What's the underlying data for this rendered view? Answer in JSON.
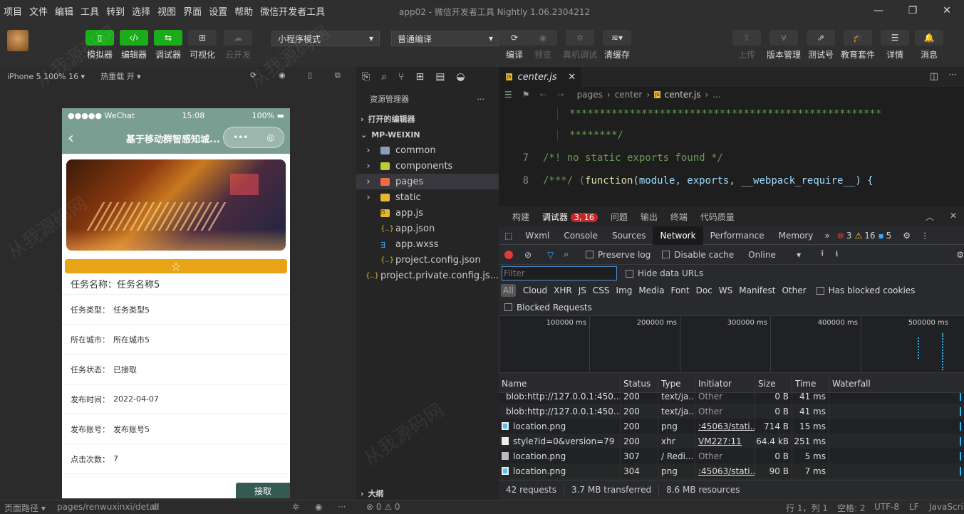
{
  "menu": [
    "项目",
    "文件",
    "编辑",
    "工具",
    "转到",
    "选择",
    "视图",
    "界面",
    "设置",
    "帮助",
    "微信开发者工具"
  ],
  "window_title": "app02 - 微信开发者工具 Nightly 1.06.2304212",
  "toolbar": {
    "simulator": "模拟器",
    "editor": "编辑器",
    "debugger": "调试器",
    "visual": "可视化",
    "cloud": "云开发",
    "mode_select": "小程序模式",
    "compile_select": "普通编译",
    "compile": "编译",
    "preview": "预览",
    "real_debug": "真机调试",
    "clear_cache": "清缓存",
    "upload": "上传",
    "version": "版本管理",
    "test": "测试号",
    "education": "教育套件",
    "details": "详情",
    "messages": "消息"
  },
  "sim_header": {
    "device": "iPhone 5 100% 16 ▾",
    "hot_reload": "热重载 开 ▾"
  },
  "phone": {
    "carrier": "●●●●● WeChat",
    "time": "15:08",
    "battery": "100%",
    "title": "基于移动群智感知城...",
    "rows": [
      {
        "key": "任务名称：",
        "value": "任务名称5"
      },
      {
        "key": "任务类型：",
        "value": "任务类型5"
      },
      {
        "key": "所在城市：",
        "value": "所在城市5"
      },
      {
        "key": "任务状态：",
        "value": "已接取"
      },
      {
        "key": "发布时间：",
        "value": "2022-04-07"
      },
      {
        "key": "发布账号：",
        "value": "发布账号5"
      },
      {
        "key": "点击次数：",
        "value": "7"
      }
    ],
    "accept_button": "接取"
  },
  "explorer": {
    "header": "资源管理器",
    "open_editors": "打开的编辑器",
    "root": "MP-WEIXIN",
    "items": [
      {
        "name": "common",
        "kind": "folder"
      },
      {
        "name": "components",
        "kind": "folder"
      },
      {
        "name": "pages",
        "kind": "folder"
      },
      {
        "name": "static",
        "kind": "folder"
      },
      {
        "name": "app.js",
        "kind": "js"
      },
      {
        "name": "app.json",
        "kind": "json"
      },
      {
        "name": "app.wxss",
        "kind": "css"
      },
      {
        "name": "project.config.json",
        "kind": "json"
      },
      {
        "name": "project.private.config.js...",
        "kind": "json"
      }
    ],
    "outline": "大纲"
  },
  "editor": {
    "tab": "center.js",
    "breadcrumb": [
      "pages",
      "center",
      "center.js",
      "..."
    ],
    "lines": [
      {
        "num": "",
        "text": "****************************************************"
      },
      {
        "num": "",
        "text": "********/"
      },
      {
        "num": "7",
        "text": "/*! no static exports found */"
      },
      {
        "num": "8",
        "text_pre": "/***/ (",
        "text_fn": "function",
        "text_args": "(module, exports, __webpack_require__) {"
      }
    ]
  },
  "devtools": {
    "top_tabs": [
      "构建",
      "调试器",
      "问题",
      "输出",
      "终端",
      "代码质量"
    ],
    "debugger_badge": "3, 16",
    "tabs": [
      "Wxml",
      "Console",
      "Sources",
      "Network",
      "Performance",
      "Memory"
    ],
    "error_count": "3",
    "warning_count": "16",
    "info_count": "5",
    "preserve_log": "Preserve log",
    "disable_cache": "Disable cache",
    "throttle": "Online",
    "filter_placeholder": "Filter",
    "hide_data_urls": "Hide data URLs",
    "types": [
      "All",
      "Cloud",
      "XHR",
      "JS",
      "CSS",
      "Img",
      "Media",
      "Font",
      "Doc",
      "WS",
      "Manifest",
      "Other"
    ],
    "blocked_cookies": "Has blocked cookies",
    "blocked_requests": "Blocked Requests",
    "overview_ticks": [
      "100000 ms",
      "200000 ms",
      "300000 ms",
      "400000 ms",
      "500000 ms"
    ],
    "columns": [
      "Name",
      "Status",
      "Type",
      "Initiator",
      "Size",
      "Time",
      "Waterfall"
    ],
    "requests": [
      {
        "name": "blob:http://127.0.0.1:450...",
        "status": "200",
        "type": "text/ja...",
        "initiator": "Other",
        "size": "0 B",
        "time": "41 ms",
        "icon": "doc"
      },
      {
        "name": "blob:http://127.0.0.1:450...",
        "status": "200",
        "type": "text/ja...",
        "initiator": "Other",
        "size": "0 B",
        "time": "41 ms",
        "icon": "doc"
      },
      {
        "name": "location.png",
        "status": "200",
        "type": "png",
        "initiator": ":45063/stati...",
        "size": "714 B",
        "time": "15 ms",
        "icon": "img"
      },
      {
        "name": "style?id=0&version=79",
        "status": "200",
        "type": "xhr",
        "initiator": "VM227:11",
        "size": "64.4 kB",
        "time": "251 ms",
        "icon": "doc"
      },
      {
        "name": "location.png",
        "status": "307",
        "type": "/ Redi...",
        "initiator": "Other",
        "size": "0 B",
        "time": "5 ms",
        "icon": "redirect"
      },
      {
        "name": "location.png",
        "status": "304",
        "type": "png",
        "initiator": ":45063/stati...",
        "size": "90 B",
        "time": "7 ms",
        "icon": "img"
      }
    ],
    "summary": [
      "42 requests",
      "3.7 MB transferred",
      "8.6 MB resources"
    ]
  },
  "statusbar": {
    "page_path_label": "页面路径 ▾",
    "page_path": "pages/renwuxinxi/detail",
    "problems": "⊗ 0 ⚠ 0",
    "position": "行 1，列 1",
    "spaces": "空格: 2",
    "encoding": "UTF-8",
    "eol": "LF",
    "language": "JavaScript"
  },
  "watermark": "从我源码网",
  "colors": {
    "accent_green": "#1aad19",
    "nav_green": "#7b9e93",
    "star_bar": "#e8a317",
    "error_red": "#e53935"
  }
}
